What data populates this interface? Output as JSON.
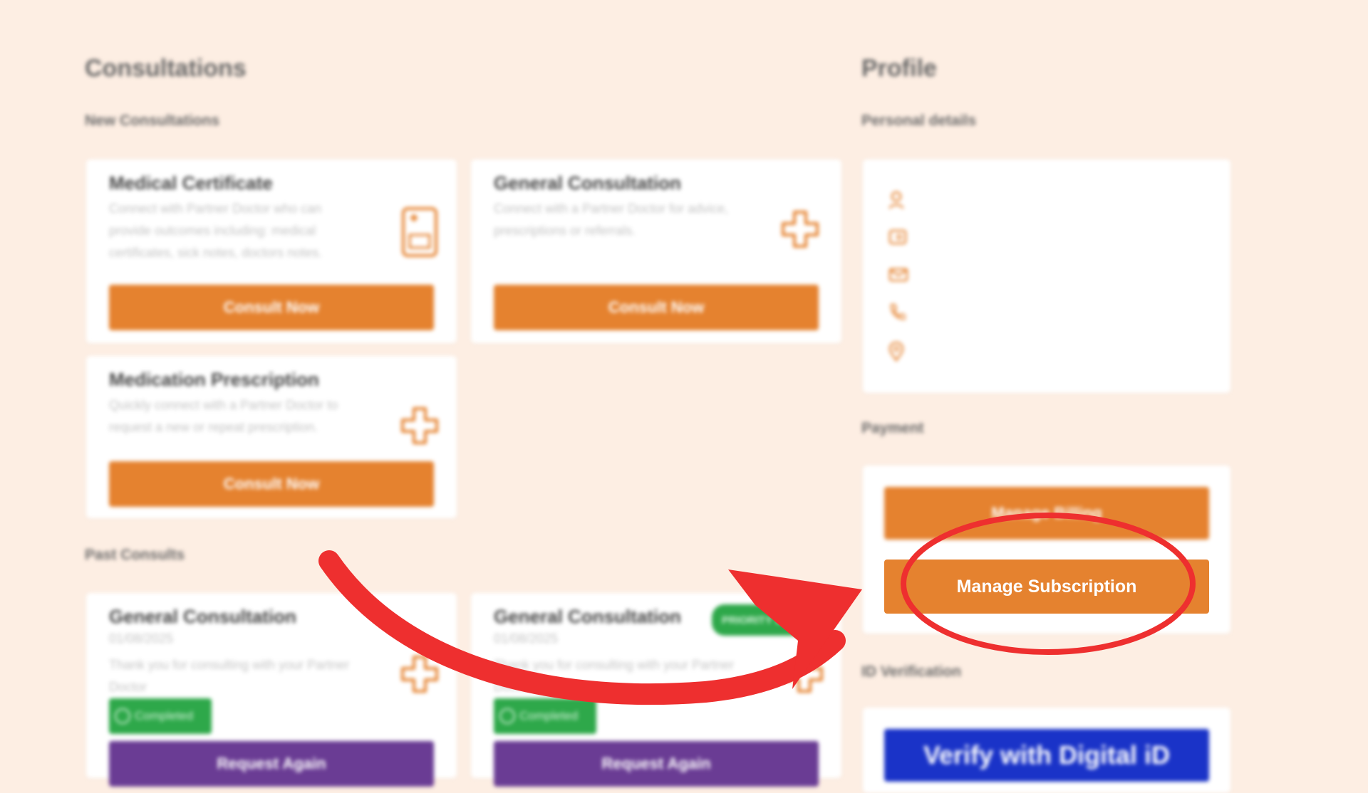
{
  "consultations": {
    "title": "Consultations",
    "new_heading": "New Consultations",
    "cards": [
      {
        "title": "Medical Certificate",
        "description": "Connect with Partner Doctor who can provide outcomes including: medical certificates, sick notes, doctors notes.",
        "button": "Consult Now",
        "icon": "medical-certificate-icon"
      },
      {
        "title": "General Consultation",
        "description": "Connect with a Partner Doctor for advice, prescriptions or referrals.",
        "button": "Consult Now",
        "icon": "medical-cross-icon"
      },
      {
        "title": "Medication Prescription",
        "description": "Quickly connect with a Partner Doctor to request a new or repeat prescription.",
        "button": "Consult Now",
        "icon": "medical-cross-icon"
      }
    ],
    "past_heading": "Past Consults",
    "past": [
      {
        "title": "General Consultation",
        "date": "01/08/2025",
        "message": "Thank you for consulting with your Partner Doctor",
        "status": "Completed",
        "button": "Request Again"
      },
      {
        "title": "General Consultation",
        "date": "01/08/2025",
        "message": "Thank you for consulting with your Partner Doctor",
        "status": "Completed",
        "badge": "PRIORITY SERVICE",
        "button": "Request Again"
      }
    ]
  },
  "profile": {
    "title": "Profile",
    "personal_heading": "Personal details",
    "personal_icons": [
      "user-icon",
      "id-card-icon",
      "mail-icon",
      "phone-icon",
      "location-pin-icon"
    ],
    "payment_heading": "Payment",
    "manage_billing": "Manage Billing",
    "manage_subscription": "Manage Subscription",
    "id_heading": "ID Verification",
    "verify_button": "Verify with Digital iD"
  },
  "colors": {
    "background": "#fdeee3",
    "accent_orange": "#e5822f",
    "purple": "#6a3c94",
    "success_green": "#2ea84a",
    "verify_blue": "#1a33c8",
    "annotation_red": "#ee2f2f"
  }
}
